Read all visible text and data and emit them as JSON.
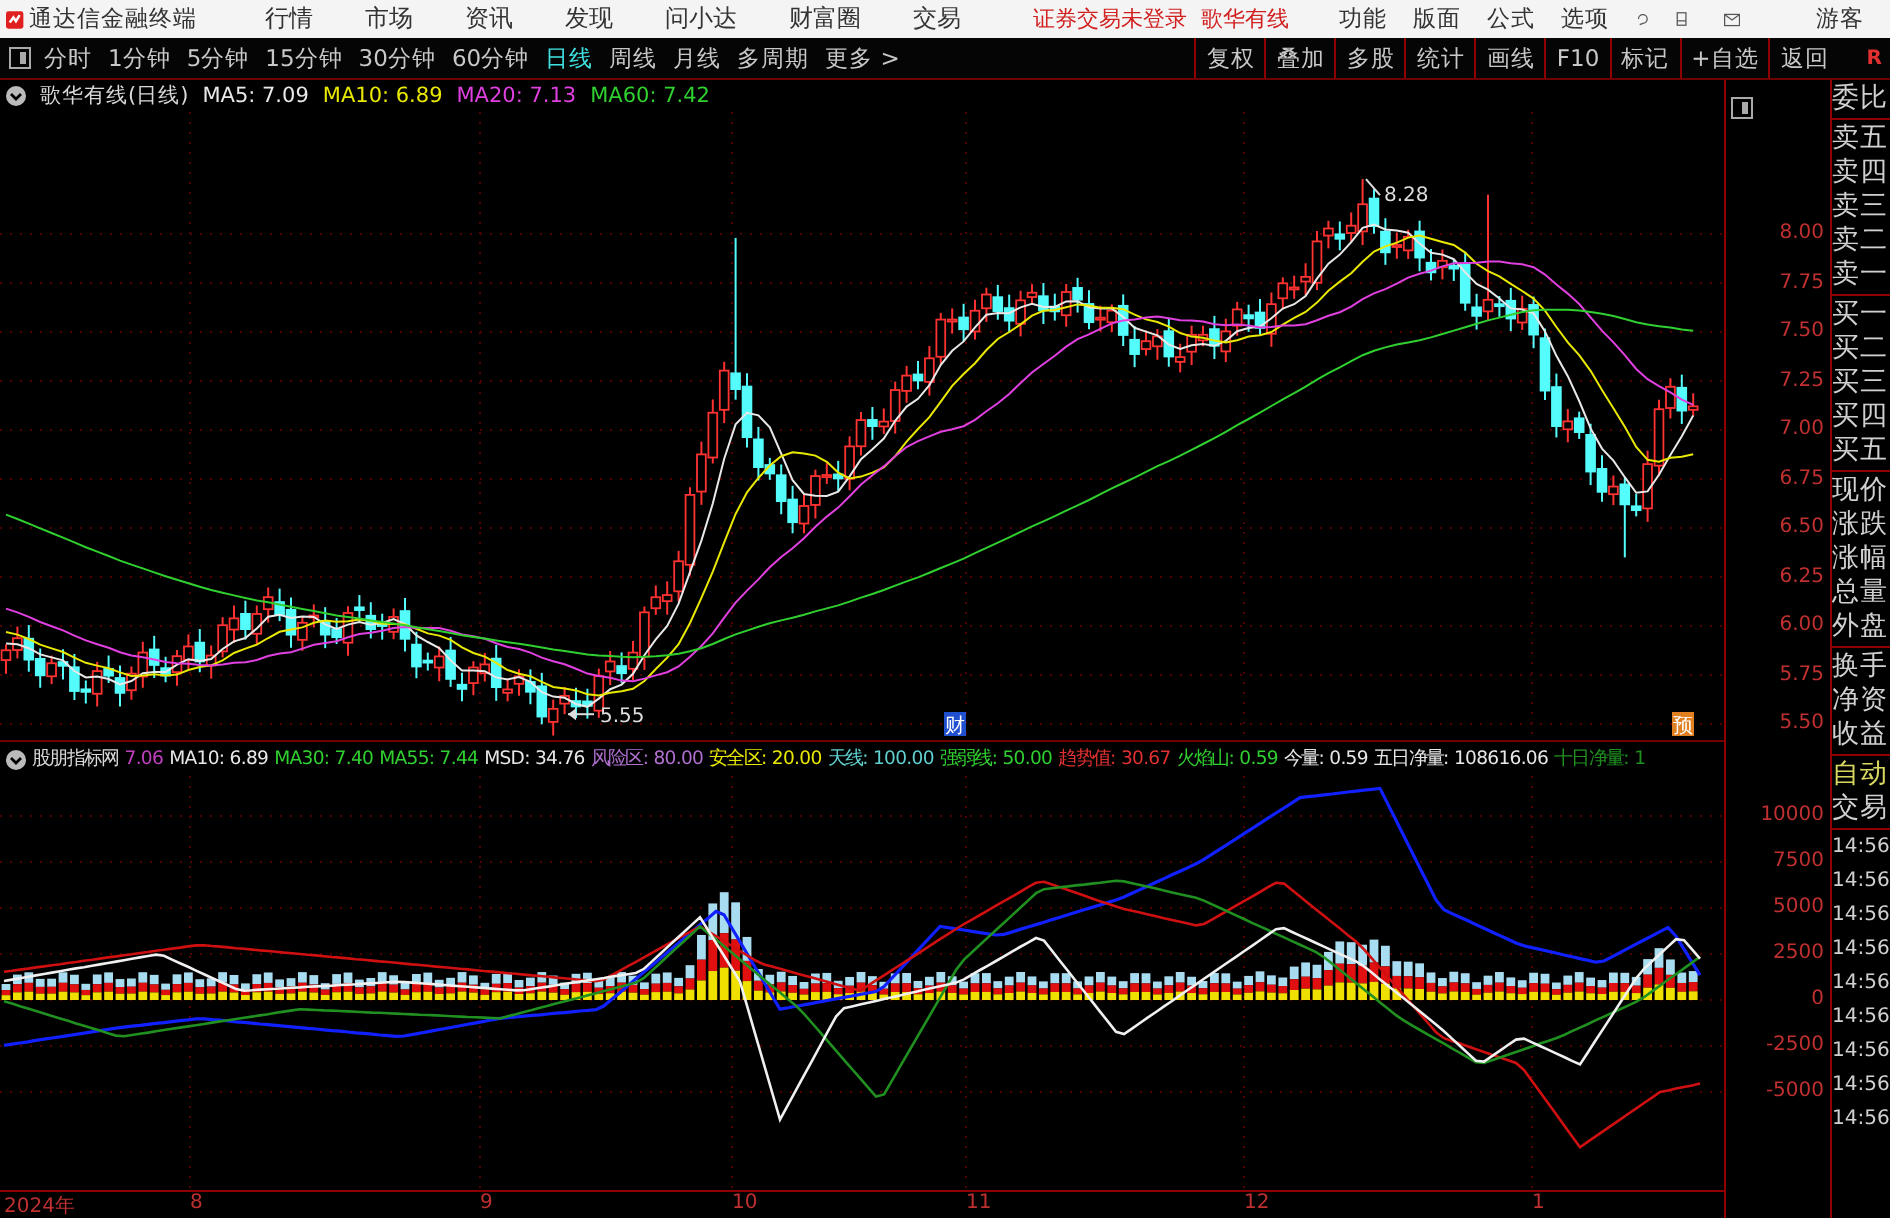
{
  "menu_bar": {
    "app_title": "通达信金融终端",
    "menus": [
      "行情",
      "市场",
      "资讯",
      "发现",
      "问小达",
      "财富圈",
      "交易"
    ],
    "status": "证券交易未登录",
    "stock": "歌华有线",
    "right_menus": [
      "功能",
      "版面",
      "公式",
      "选项"
    ],
    "user": "游客"
  },
  "toolbar": {
    "periods": [
      {
        "label": "分时",
        "selected": false
      },
      {
        "label": "1分钟",
        "selected": false
      },
      {
        "label": "5分钟",
        "selected": false
      },
      {
        "label": "15分钟",
        "selected": false
      },
      {
        "label": "30分钟",
        "selected": false
      },
      {
        "label": "60分钟",
        "selected": false
      },
      {
        "label": "日线",
        "selected": true
      },
      {
        "label": "周线",
        "selected": false
      },
      {
        "label": "月线",
        "selected": false
      },
      {
        "label": "多周期",
        "selected": false
      },
      {
        "label": "更多 >",
        "selected": false
      }
    ],
    "buttons": [
      "复权",
      "叠加",
      "多股",
      "统计",
      "画线",
      "F10",
      "标记",
      "+自选",
      "返回"
    ],
    "mark": "R"
  },
  "price_chart": {
    "title": "歌华有线(日线)",
    "ma_legend": [
      {
        "text": "MA5: 7.09",
        "color": "#e8e8e8"
      },
      {
        "text": "MA10: 6.89",
        "color": "#e8e800"
      },
      {
        "text": "MA20: 7.13",
        "color": "#e040e0"
      },
      {
        "text": "MA60: 7.42",
        "color": "#30d030"
      }
    ],
    "high_marker": "8.28",
    "low_marker": "5.55",
    "event_badges": [
      {
        "text": "财",
        "kind": "finance"
      },
      {
        "text": "预",
        "kind": "forecast"
      }
    ],
    "axis_ticks": [
      "8.00",
      "7.75",
      "7.50",
      "7.25",
      "7.00",
      "6.75",
      "6.50",
      "6.25",
      "6.00",
      "5.75",
      "5.50"
    ]
  },
  "indicator": {
    "title": "股朋指标网",
    "values": [
      {
        "text": "7.06",
        "color": "#c040c0"
      },
      {
        "text": "MA10: 6.89",
        "color": "#e8e8e8"
      },
      {
        "text": "MA30: 7.40",
        "color": "#30d030"
      },
      {
        "text": "MA55: 7.44",
        "color": "#30d030"
      },
      {
        "text": "MSD: 34.76",
        "color": "#e8e8e8"
      },
      {
        "text": "风险区: 80.00",
        "color": "#b070d0"
      },
      {
        "text": "安全区: 20.00",
        "color": "#e8e800"
      },
      {
        "text": "天线: 100.00",
        "color": "#60d0d0"
      },
      {
        "text": "强弱线: 50.00",
        "color": "#30d030"
      },
      {
        "text": "趋势值: 30.67",
        "color": "#e03030"
      },
      {
        "text": "火焰山: 0.59",
        "color": "#30d030"
      },
      {
        "text": "今量: 0.59",
        "color": "#e8e8e8"
      },
      {
        "text": "五日净量: 108616.06",
        "color": "#e8e8e8"
      },
      {
        "text": "十日净量: 1",
        "color": "#209020"
      }
    ],
    "axis_ticks": [
      "10000",
      "7500",
      "5000",
      "2500",
      "0",
      "-2500",
      "-5000"
    ]
  },
  "time_axis": [
    "2024年",
    "8",
    "9",
    "10",
    "11",
    "12",
    "1"
  ],
  "quote_panel": {
    "groups": [
      [
        "委比"
      ],
      [
        "卖五",
        "卖四",
        "卖三",
        "卖二",
        "卖一"
      ],
      [
        "买一",
        "买二",
        "买三",
        "买四",
        "买五"
      ],
      [
        "现价",
        "涨跌",
        "涨幅",
        "总量",
        "外盘"
      ],
      [
        "换手",
        "净资",
        "收益"
      ]
    ],
    "trade_tabs": [
      {
        "label": "自动",
        "selected": true
      },
      {
        "label": "交易",
        "selected": false
      }
    ],
    "times": [
      "14:56",
      "14:56",
      "14:56",
      "14:56",
      "14:56",
      "14:56",
      "14:56",
      "14:56",
      "14:56"
    ]
  }
}
